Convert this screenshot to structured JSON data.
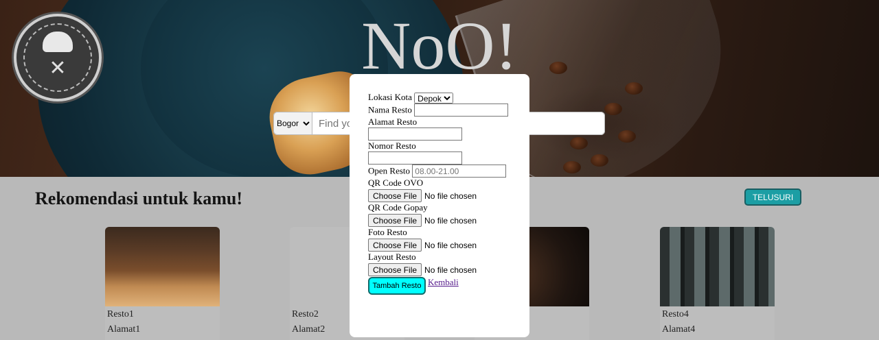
{
  "hero": {
    "title": "NoO!",
    "city_select": "Bogor",
    "search_placeholder": "Find your resto"
  },
  "section": {
    "title": "Rekomendasi untuk kamu!",
    "explore_label": "TELUSURI"
  },
  "cards": [
    {
      "name": "Resto1",
      "address": "Alamat1"
    },
    {
      "name": "Resto2",
      "address": "Alamat2"
    },
    {
      "name": "",
      "address": ""
    },
    {
      "name": "Resto4",
      "address": "Alamat4"
    }
  ],
  "form": {
    "city_label": "Lokasi Kota",
    "city_value": "Depok",
    "name_label": "Nama Resto",
    "address_label": "Alamat Resto",
    "phone_label": "Nomor Resto",
    "open_label": "Open Resto",
    "open_placeholder": "08.00-21.00",
    "ovo_label": "QR Code OVO",
    "gopay_label": "QR Code Gopay",
    "photo_label": "Foto Resto",
    "layout_label": "Layout Resto",
    "choose_file": "Choose File",
    "no_file": "No file chosen",
    "submit_label": "Tambah Resto",
    "back_label": "Kembali"
  },
  "colors": {
    "accent_cyan": "#00ffff",
    "explore_button": "#1c9ea4",
    "link_purple": "#551a8b"
  }
}
